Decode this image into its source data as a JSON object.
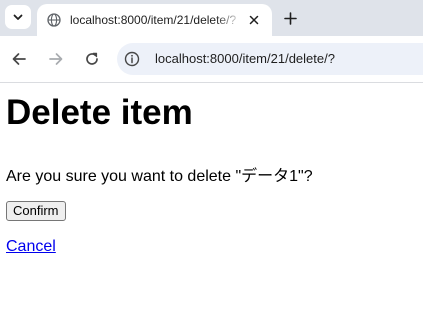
{
  "browser": {
    "tab": {
      "title": "localhost:8000/item/21/delete/?",
      "favicon": "globe-icon"
    },
    "address_bar": {
      "url": "localhost:8000/item/21/delete/?"
    },
    "icons": {
      "tab_menu": "chevron-down-icon",
      "tab_close": "close-icon",
      "new_tab": "plus-icon",
      "back": "arrow-left-icon",
      "forward": "arrow-right-icon",
      "reload": "reload-icon",
      "site_info": "info-icon"
    },
    "colors": {
      "tabstrip_bg": "#dfe3ea",
      "omnibox_bg": "#edf1f9"
    }
  },
  "page": {
    "heading": "Delete item",
    "message": "Are you sure you want to delete \"データ1\"?",
    "confirm_label": "Confirm",
    "cancel_label": "Cancel",
    "link_color": "#0000ee"
  }
}
